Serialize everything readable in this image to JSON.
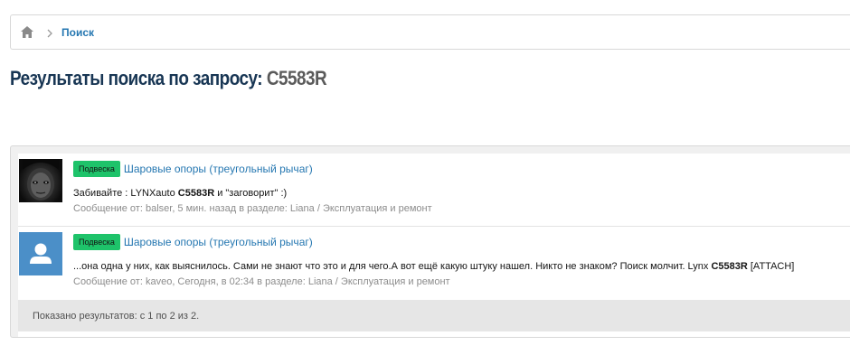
{
  "breadcrumb": {
    "current": "Поиск"
  },
  "page": {
    "title_prefix": "Результаты поиска по запросу:",
    "query": "C5583R"
  },
  "results": [
    {
      "prefix": "Подвеска",
      "thread": "Шаровые опоры (треугольный рычаг)",
      "snippet_before": "Забивайте : LYNXauto ",
      "snippet_match": "C5583R",
      "snippet_after": " и \"заговорит\" :)",
      "meta_prefix": "Сообщение от: ",
      "author": "balser",
      "time": ", 5 мин. назад",
      "section_prefix": " в разделе: ",
      "section": "Liana / Эксплуатация и ремонт"
    },
    {
      "prefix": "Подвеска",
      "thread": "Шаровые опоры (треугольный рычаг)",
      "snippet_before": "...она одна у них, как выяснилось. Сами не знают что это и для чего.А вот ещё какую штуку нашел. Никто не знаком? Поиск молчит. Lynx ",
      "snippet_match": "C5583R",
      "snippet_after": " [ATTACH]",
      "meta_prefix": "Сообщение от: ",
      "author": "kaveo",
      "time": ", Сегодня, в 02:34",
      "section_prefix": " в разделе: ",
      "section": "Liana / Эксплуатация и ремонт"
    }
  ],
  "footer": {
    "summary": "Показано результатов: с 1 по 2 из 2."
  },
  "colors": {
    "accent": "#2577b1",
    "prefix_green": "#1ec36a",
    "title": "#183654"
  },
  "icons": {
    "home": "home-icon",
    "separator": "chevron-right-icon"
  }
}
